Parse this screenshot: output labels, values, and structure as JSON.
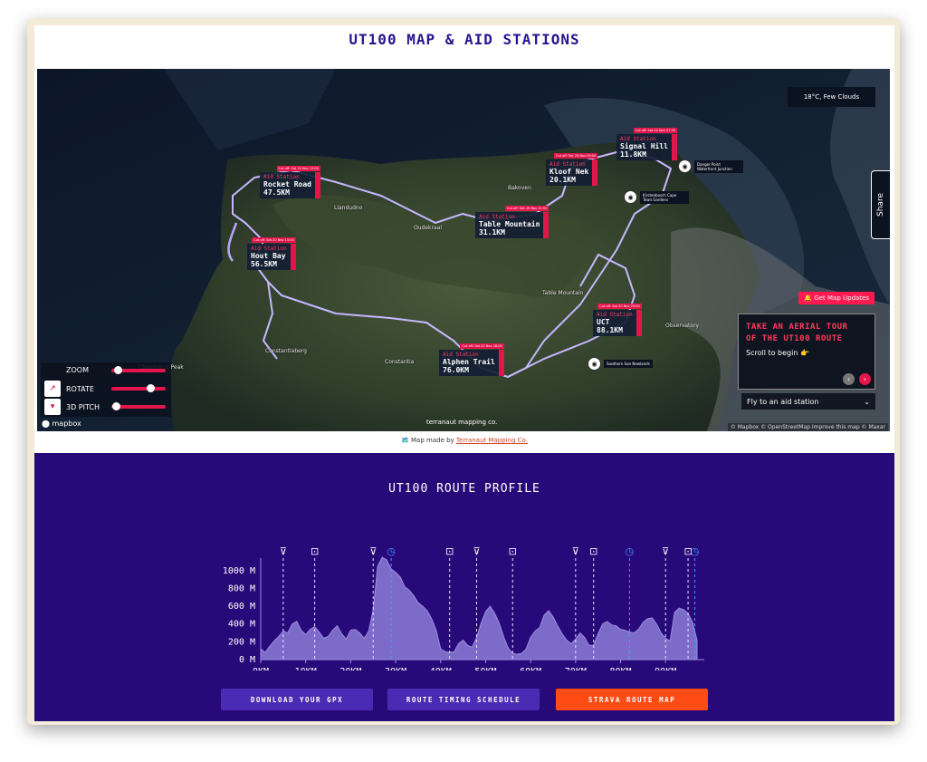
{
  "page": {
    "title": "UT100 MAP & AID STATIONS"
  },
  "map": {
    "weather": "18°C, Few Clouds",
    "share_label": "Share",
    "watermark": "terranaut mapping co.",
    "mapbox_logo": "mapbox",
    "attribution": "© Mapbox © OpenStreetMap Improve this map © Maxar",
    "station_kicker": "Aid Station",
    "stations": [
      {
        "name": "Rocket Road",
        "dist": "47.5KM",
        "tag": "Cut off: Sat 20 Nov 13:00"
      },
      {
        "name": "Kloof Nek",
        "dist": "20.1KM",
        "tag": "Cut off: Sat 20 Nov 09:00"
      },
      {
        "name": "Signal Hill",
        "dist": "11.8KM",
        "tag": "Cut off: Sat 20 Nov 07:30"
      },
      {
        "name": "Table Mountain",
        "dist": "31.1KM",
        "tag": "Cut off: Sat 20 Nov 11:00"
      },
      {
        "name": "Hout Bay",
        "dist": "56.5KM",
        "tag": "Cut off: Sat 20 Nov 15:00"
      },
      {
        "name": "UCT",
        "dist": "88.1KM",
        "tag": "Cut off: Sat 20 Nov 20:00"
      },
      {
        "name": "Alphen Trail",
        "dist": "76.0KM",
        "tag": "Cut off: Sat 20 Nov 18:00"
      }
    ],
    "pois": [
      {
        "icon": "camera-icon",
        "label": "Danger Point Waterfront Junction"
      },
      {
        "icon": "camera-icon",
        "label": "Kirstenbosch Cape Town Gardens"
      },
      {
        "icon": "camera-icon",
        "label": "Southern Sun Newlands"
      }
    ],
    "place_labels": [
      "Llandudno",
      "Bakoven",
      "Oudekraal",
      "Table Mountain",
      "Constantiaberg",
      "Constantia",
      "Observatory",
      "Chapman's Peak"
    ],
    "controls": {
      "zoom": "ZOOM",
      "rotate": "ROTATE",
      "pitch": "3D PITCH",
      "zoom_level": 0.05,
      "rotate_level": 0.75,
      "pitch_level": 0.02
    },
    "updates_button": "🔔 Get Map Updates",
    "tour": {
      "heading_line1": "Take an aerial tour",
      "heading_line2": "of the UT100 route",
      "subtitle": "Scroll to begin 👉"
    },
    "flyto": {
      "label": "Fly to an aid station",
      "chevron": "⌄"
    },
    "colors": {
      "accent": "#e4154b",
      "route": "#b9a6ff"
    }
  },
  "made_by": {
    "prefix": "🗺️ Map made by ",
    "link": "Terranaut Mapping Co."
  },
  "profile": {
    "title": "UT100 ROUTE PROFILE",
    "buttons": {
      "gpx": "DOWNLOAD YOUR GPX",
      "timing": "ROUTE TIMING SCHEDULE",
      "strava": "STRAVA ROUTE MAP"
    },
    "colors": {
      "background": "#28097a",
      "area": "#7d6bc9",
      "strava": "#ff4b14",
      "button": "#4a2bb3"
    }
  },
  "chart_data": {
    "type": "area",
    "title": "UT100 ROUTE PROFILE",
    "xlabel": "",
    "ylabel": "",
    "xlim": [
      0,
      97
    ],
    "ylim": [
      0,
      1100
    ],
    "xticks": [
      0,
      10,
      20,
      30,
      40,
      50,
      60,
      70,
      80,
      90
    ],
    "xtick_labels": [
      "0KM",
      "10KM",
      "20KM",
      "30KM",
      "40KM",
      "50KM",
      "60KM",
      "70KM",
      "80KM",
      "90KM"
    ],
    "yticks": [
      0,
      200,
      400,
      600,
      800,
      1000
    ],
    "ytick_labels": [
      "0 M",
      "200 M",
      "400 M",
      "600 M",
      "800 M",
      "1000 M"
    ],
    "series": [
      {
        "x": [
          0,
          1,
          2,
          3,
          4,
          5,
          6,
          7,
          8,
          9,
          10,
          11,
          12,
          13,
          14,
          15,
          16,
          17,
          18,
          19,
          20,
          21,
          22,
          23,
          24,
          25,
          26,
          27,
          28,
          29,
          30,
          31,
          32,
          33,
          34,
          35,
          36,
          37,
          38,
          39,
          40,
          41,
          42,
          43,
          44,
          45,
          46,
          47,
          48,
          49,
          50,
          51,
          52,
          53,
          54,
          55,
          56,
          57,
          58,
          59,
          60,
          61,
          62,
          63,
          64,
          65,
          66,
          67,
          68,
          69,
          70,
          71,
          72,
          73,
          74,
          75,
          76,
          77,
          78,
          79,
          80,
          81,
          82,
          83,
          84,
          85,
          86,
          87,
          88,
          89,
          90,
          91,
          92,
          93,
          94,
          95,
          96,
          97
        ],
        "y": [
          120,
          80,
          150,
          210,
          260,
          320,
          300,
          400,
          430,
          330,
          280,
          340,
          370,
          310,
          240,
          260,
          330,
          380,
          290,
          230,
          330,
          340,
          300,
          240,
          320,
          560,
          1050,
          1150,
          1120,
          1020,
          980,
          930,
          820,
          780,
          720,
          640,
          600,
          550,
          460,
          330,
          120,
          90,
          80,
          90,
          180,
          220,
          160,
          140,
          250,
          410,
          540,
          600,
          520,
          410,
          260,
          130,
          70,
          60,
          70,
          120,
          250,
          320,
          360,
          500,
          550,
          480,
          380,
          290,
          220,
          180,
          230,
          300,
          250,
          160,
          160,
          290,
          400,
          430,
          390,
          380,
          340,
          330,
          310,
          300,
          340,
          420,
          460,
          470,
          400,
          300,
          240,
          210,
          530,
          580,
          560,
          520,
          420,
          220
        ]
      }
    ],
    "markers": [
      {
        "km": 5,
        "icon": "cup-icon",
        "style": "dashed"
      },
      {
        "km": 12,
        "icon": "car-icon",
        "style": "dashed"
      },
      {
        "km": 25,
        "icon": "cup-icon",
        "style": "dashed"
      },
      {
        "km": 29,
        "icon": "stopwatch-icon",
        "style": "blue"
      },
      {
        "km": 42,
        "icon": "car-icon",
        "style": "dashed"
      },
      {
        "km": 48,
        "icon": "cup-icon",
        "style": "dashed"
      },
      {
        "km": 56,
        "icon": "car-icon",
        "style": "dashed"
      },
      {
        "km": 70,
        "icon": "cup-icon",
        "style": "dashed"
      },
      {
        "km": 74,
        "icon": "car-icon",
        "style": "dashed"
      },
      {
        "km": 82,
        "icon": "stopwatch-icon",
        "style": "blue"
      },
      {
        "km": 90,
        "icon": "cup-icon",
        "style": "dashed"
      },
      {
        "km": 95,
        "icon": "car-icon",
        "style": "dashed"
      },
      {
        "km": 96.5,
        "icon": "stopwatch-icon",
        "style": "blue"
      }
    ]
  }
}
